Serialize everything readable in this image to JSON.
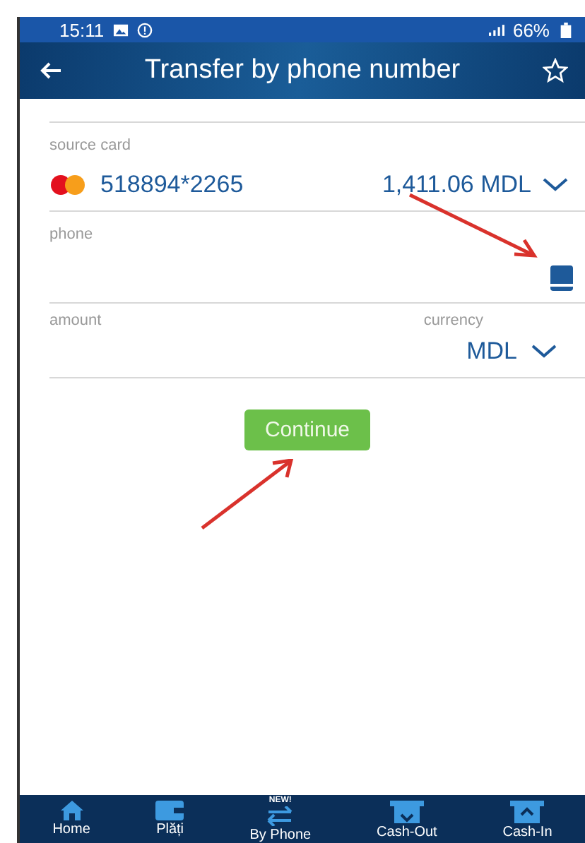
{
  "status_bar": {
    "time": "15:11",
    "battery": "66%"
  },
  "header": {
    "title": "Transfer by phone number"
  },
  "source_card": {
    "label": "source card",
    "card_number": "518894*2265",
    "balance": "1,411.06 MDL"
  },
  "phone": {
    "label": "phone"
  },
  "amount": {
    "label": "amount"
  },
  "currency": {
    "label": "currency",
    "value": "MDL"
  },
  "continue_button": "Continue",
  "bottom_nav": [
    {
      "kind": "home",
      "label": "Home"
    },
    {
      "kind": "wallet",
      "label": "Plăți"
    },
    {
      "kind": "phone",
      "label": "By Phone",
      "badge": "NEW!"
    },
    {
      "kind": "cashout",
      "label": "Cash-Out"
    },
    {
      "kind": "cashin",
      "label": "Cash-In"
    }
  ]
}
